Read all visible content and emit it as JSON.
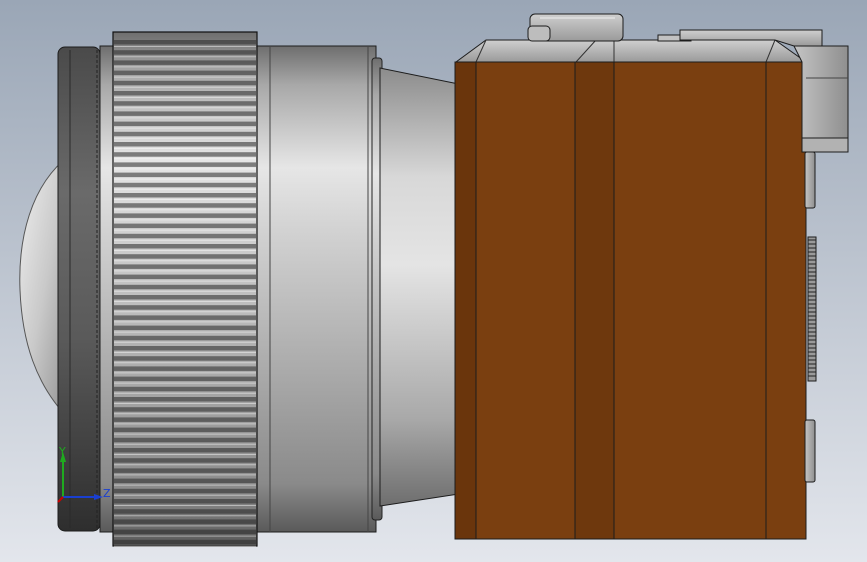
{
  "viewport": {
    "background_top": "#9aa6b6",
    "background_bottom": "#e3e6ec"
  },
  "model": {
    "lens_metal_light": "#e2e2e2",
    "lens_metal_dark": "#6f6f6f",
    "body_brown": "#7a3f10",
    "body_brown_dark": "#5e2f0b",
    "edge_color": "#1c1c1c"
  },
  "triad": {
    "y_label": "Y",
    "z_label": "Z",
    "y_color": "#1faa1f",
    "z_color": "#1a3fd0"
  }
}
